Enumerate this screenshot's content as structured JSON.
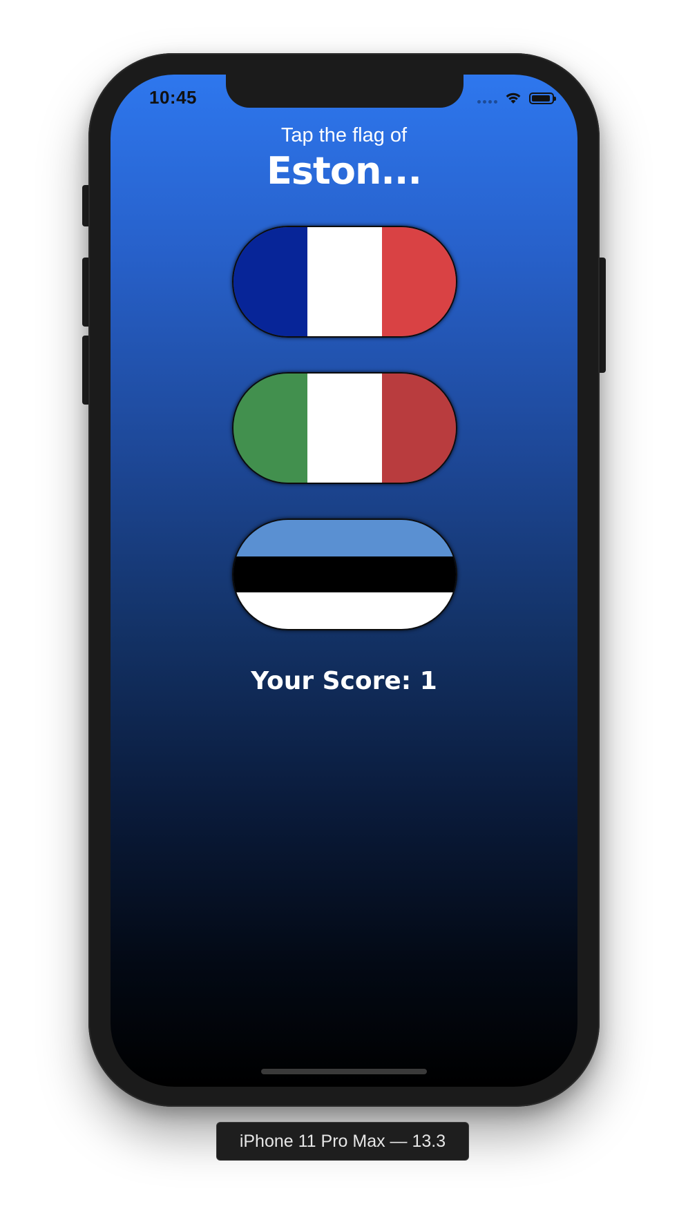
{
  "status_bar": {
    "time": "10:45",
    "icons": [
      "signal-dots-icon",
      "wifi-icon",
      "battery-icon"
    ]
  },
  "prompt": {
    "label": "Tap the flag of",
    "country": "Eston..."
  },
  "flags": [
    {
      "name": "flag-france",
      "orientation": "vertical",
      "colors": [
        "#072598",
        "#ffffff",
        "#d94244"
      ]
    },
    {
      "name": "flag-italy",
      "orientation": "vertical",
      "colors": [
        "#42904e",
        "#ffffff",
        "#b93c3e"
      ]
    },
    {
      "name": "flag-estonia",
      "orientation": "horizontal",
      "colors": [
        "#5a90d2",
        "#000000",
        "#ffffff"
      ]
    }
  ],
  "score": {
    "label": "Your Score: 1"
  },
  "device": {
    "label": "iPhone 11 Pro Max — 13.3"
  },
  "theme": {
    "gradient_top": "#2e77ee",
    "gradient_bottom": "#000000",
    "text": "#ffffff"
  }
}
